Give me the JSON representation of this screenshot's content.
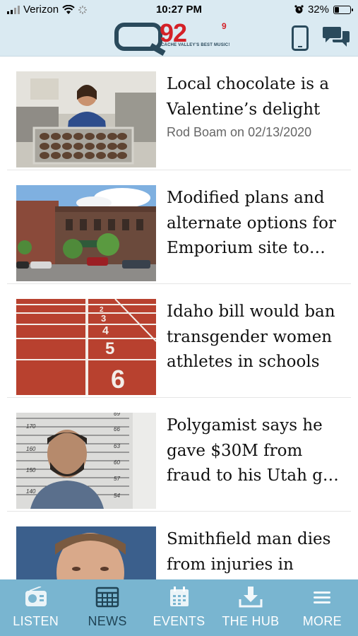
{
  "status_bar": {
    "carrier": "Verizon",
    "time": "10:27 PM",
    "battery_percent": "32%",
    "battery_level": 0.32,
    "icons": [
      "signal-icon",
      "wifi-icon",
      "activity-icon",
      "alarm-icon",
      "battery-icon"
    ]
  },
  "header": {
    "logo_text": "92",
    "logo_superscript": "9",
    "logo_tagline": "CACHE VALLEY'S BEST MUSIC!",
    "icons": [
      "phone-icon",
      "chat-icon"
    ],
    "background": "#daeaf2",
    "accent": "#d42027"
  },
  "articles": [
    {
      "headline": "Local chocolate is a Valentine’s delight",
      "byline": "Rod Boam on 02/13/2020",
      "image": "woman holding tray of chocolates"
    },
    {
      "headline": "Modified plans and alternate options for Emporium site to…",
      "byline": "",
      "image": "street with brick buildings"
    },
    {
      "headline": "Idaho bill would ban transgender women athletes in schools",
      "byline": "",
      "image": "running track lanes"
    },
    {
      "headline": "Polygamist says he gave $30M from fraud to his Utah g…",
      "byline": "",
      "image": "mugshot"
    },
    {
      "headline": "Smithfield man dies from injuries in",
      "byline": "",
      "image": "portrait photo"
    }
  ],
  "tabs": [
    {
      "label": "LISTEN",
      "icon": "radio-icon",
      "active": false
    },
    {
      "label": "NEWS",
      "icon": "newspaper-icon",
      "active": true
    },
    {
      "label": "EVENTS",
      "icon": "calendar-icon",
      "active": false
    },
    {
      "label": "THE HUB",
      "icon": "download-icon",
      "active": false
    },
    {
      "label": "MORE",
      "icon": "menu-icon",
      "active": false
    }
  ],
  "tabbar_color": "#79b5d0"
}
